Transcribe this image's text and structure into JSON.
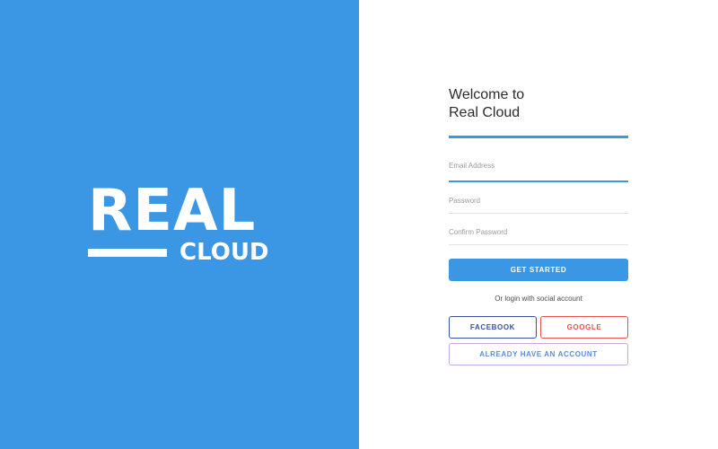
{
  "brand": {
    "logo_main": "REAL",
    "logo_sub": "CLOUD"
  },
  "form": {
    "welcome_line1": "Welcome to",
    "welcome_line2": "Real Cloud",
    "email_placeholder": "Email Address",
    "password_placeholder": "Password",
    "confirm_password_placeholder": "Confirm Password",
    "get_started_label": "GET STARTED",
    "social_note": "Or login with social account",
    "facebook_label": "FACEBOOK",
    "google_label": "GOOGLE",
    "already_account_label": "ALREADY HAVE AN ACCOUNT"
  },
  "colors": {
    "brand_blue": "#3b97e3",
    "facebook": "#3a4fa0",
    "google": "#e8504a"
  }
}
